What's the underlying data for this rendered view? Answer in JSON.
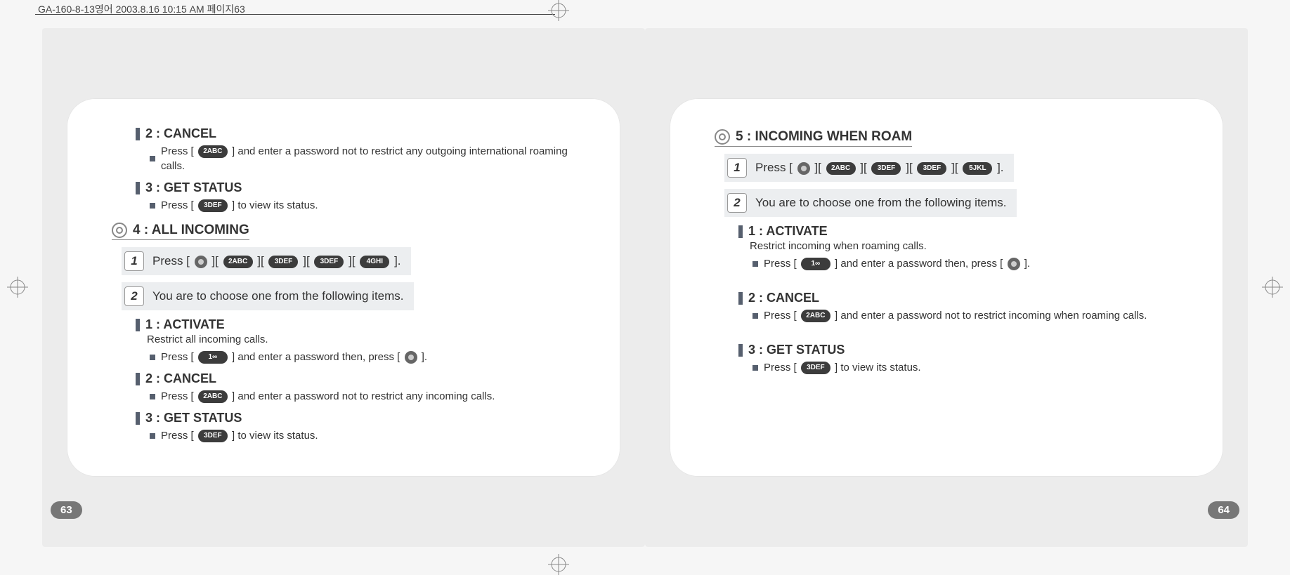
{
  "crop": {
    "header": "GA-160-8-13영어   2003.8.16 10:15 AM   페이지63"
  },
  "keys": {
    "k1": "1∞",
    "k2": "2ABC",
    "k3": "3DEF",
    "k4": "4GHI",
    "k5": "5JKL"
  },
  "page_left": {
    "number": "63",
    "top": {
      "cancel": {
        "title": "2 : CANCEL",
        "text1": "Press [",
        "text2": "] and enter a password not to restrict any outgoing international roaming calls."
      },
      "get_status": {
        "title": "3 : GET STATUS",
        "text1": "Press [",
        "text2": "] to view its status."
      }
    },
    "section": {
      "title": "4 : ALL INCOMING",
      "step1": {
        "num": "1",
        "a": "Press [",
        "b": "][",
        "c": "][",
        "d": "][",
        "e": "][",
        "f": "]."
      },
      "step2": {
        "num": "2",
        "text": "You are to choose one from the following items."
      },
      "activate": {
        "title": "1 : ACTIVATE",
        "desc": "Restrict all incoming calls.",
        "t1": "Press [",
        "t2": "] and enter a password then, press [",
        "t3": "]."
      },
      "cancel": {
        "title": "2 : CANCEL",
        "t1": "Press [",
        "t2": "] and enter a password not to restrict any incoming calls."
      },
      "get_status": {
        "title": "3 : GET STATUS",
        "t1": "Press [",
        "t2": "] to view its status."
      }
    }
  },
  "page_right": {
    "number": "64",
    "section": {
      "title": "5 : INCOMING WHEN ROAM",
      "step1": {
        "num": "1",
        "a": "Press [",
        "b": "][",
        "c": "][",
        "d": "][",
        "e": "][",
        "f": "]."
      },
      "step2": {
        "num": "2",
        "text": "You are to choose one from the following items."
      },
      "activate": {
        "title": "1 : ACTIVATE",
        "desc": "Restrict incoming when roaming calls.",
        "t1": "Press [",
        "t2": "] and enter a password then, press [",
        "t3": "]."
      },
      "cancel": {
        "title": "2 : CANCEL",
        "t1": "Press [",
        "t2": "] and enter a password not to restrict incoming when roaming calls."
      },
      "get_status": {
        "title": "3 : GET STATUS",
        "t1": "Press [",
        "t2": "] to view its status."
      }
    }
  }
}
